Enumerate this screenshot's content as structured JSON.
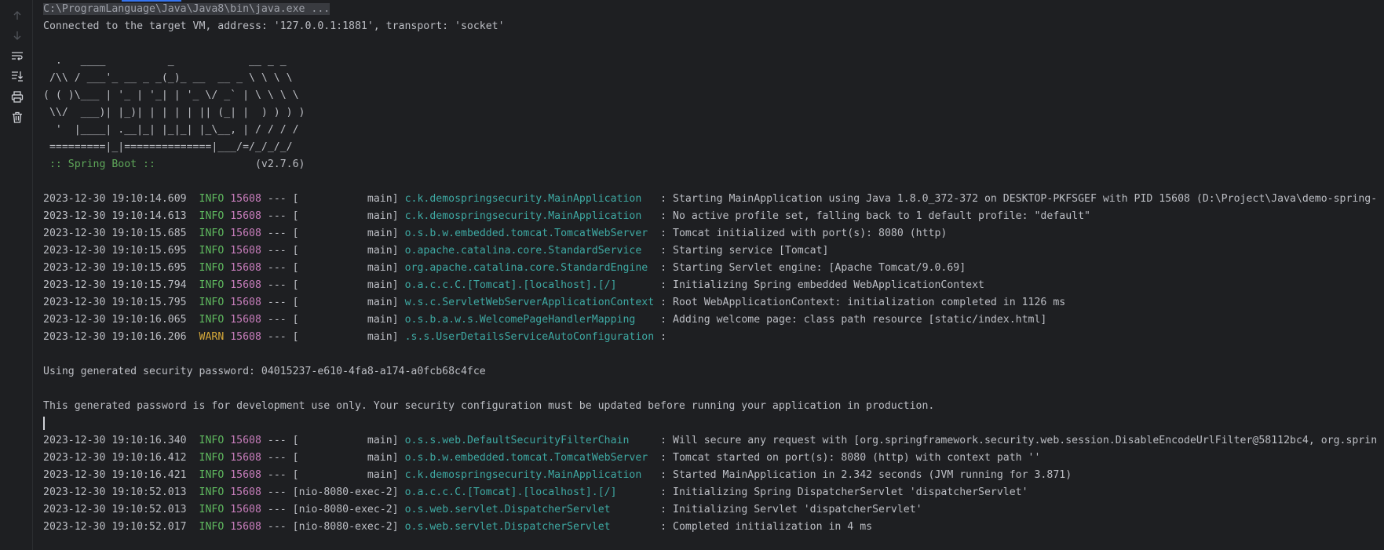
{
  "toolbar": {
    "icons": [
      "arrow-up-icon",
      "arrow-down-icon",
      "soft-wrap-icon",
      "scroll-to-end-icon",
      "print-icon",
      "trash-icon"
    ]
  },
  "console": {
    "command": "C:\\ProgramLanguage\\Java\\Java8\\bin\\java.exe ...",
    "connected": "Connected to the target VM, address: '127.0.0.1:1881', transport: 'socket'",
    "banner": [
      "",
      "  .   ____          _            __ _ _",
      " /\\\\ / ___'_ __ _ _(_)_ __  __ _ \\ \\ \\ \\",
      "( ( )\\___ | '_ | '_| | '_ \\/ _` | \\ \\ \\ \\",
      " \\\\/  ___)| |_)| | | | | || (_| |  ) ) ) )",
      "  '  |____| .__|_| |_|_| |_\\__, | / / / /",
      " =========|_|==============|___/=/_/_/_/"
    ],
    "boot_label": " :: Spring Boot :: ",
    "boot_version": "               (v2.7.6)",
    "logs1": [
      {
        "ts": "2023-12-30 19:10:14.609",
        "level": "INFO",
        "pid": "15608",
        "thread": "[           main]",
        "logger": "c.k.demospringsecurity.MainApplication  ",
        "msg": ": Starting MainApplication using Java 1.8.0_372-372 on DESKTOP-PKFSGEF with PID 15608 (D:\\Project\\Java\\demo-spring-"
      },
      {
        "ts": "2023-12-30 19:10:14.613",
        "level": "INFO",
        "pid": "15608",
        "thread": "[           main]",
        "logger": "c.k.demospringsecurity.MainApplication  ",
        "msg": ": No active profile set, falling back to 1 default profile: \"default\""
      },
      {
        "ts": "2023-12-30 19:10:15.685",
        "level": "INFO",
        "pid": "15608",
        "thread": "[           main]",
        "logger": "o.s.b.w.embedded.tomcat.TomcatWebServer ",
        "msg": ": Tomcat initialized with port(s): 8080 (http)"
      },
      {
        "ts": "2023-12-30 19:10:15.695",
        "level": "INFO",
        "pid": "15608",
        "thread": "[           main]",
        "logger": "o.apache.catalina.core.StandardService  ",
        "msg": ": Starting service [Tomcat]"
      },
      {
        "ts": "2023-12-30 19:10:15.695",
        "level": "INFO",
        "pid": "15608",
        "thread": "[           main]",
        "logger": "org.apache.catalina.core.StandardEngine ",
        "msg": ": Starting Servlet engine: [Apache Tomcat/9.0.69]"
      },
      {
        "ts": "2023-12-30 19:10:15.794",
        "level": "INFO",
        "pid": "15608",
        "thread": "[           main]",
        "logger": "o.a.c.c.C.[Tomcat].[localhost].[/]      ",
        "msg": ": Initializing Spring embedded WebApplicationContext"
      },
      {
        "ts": "2023-12-30 19:10:15.795",
        "level": "INFO",
        "pid": "15608",
        "thread": "[           main]",
        "logger": "w.s.c.ServletWebServerApplicationContext",
        "msg": ": Root WebApplicationContext: initialization completed in 1126 ms"
      },
      {
        "ts": "2023-12-30 19:10:16.065",
        "level": "INFO",
        "pid": "15608",
        "thread": "[           main]",
        "logger": "o.s.b.a.w.s.WelcomePageHandlerMapping   ",
        "msg": ": Adding welcome page: class path resource [static/index.html]"
      },
      {
        "ts": "2023-12-30 19:10:16.206",
        "level": "WARN",
        "pid": "15608",
        "thread": "[           main]",
        "logger": ".s.s.UserDetailsServiceAutoConfiguration",
        "msg": ":"
      }
    ],
    "password_line": "Using generated security password: 04015237-e610-4fa8-a174-a0fcb68c4fce",
    "dev_note": "This generated password is for development use only. Your security configuration must be updated before running your application in production.",
    "logs2": [
      {
        "ts": "2023-12-30 19:10:16.340",
        "level": "INFO",
        "pid": "15608",
        "thread": "[           main]",
        "logger": "o.s.s.web.DefaultSecurityFilterChain    ",
        "msg": ": Will secure any request with [org.springframework.security.web.session.DisableEncodeUrlFilter@58112bc4, org.sprin"
      },
      {
        "ts": "2023-12-30 19:10:16.412",
        "level": "INFO",
        "pid": "15608",
        "thread": "[           main]",
        "logger": "o.s.b.w.embedded.tomcat.TomcatWebServer ",
        "msg": ": Tomcat started on port(s): 8080 (http) with context path ''"
      },
      {
        "ts": "2023-12-30 19:10:16.421",
        "level": "INFO",
        "pid": "15608",
        "thread": "[           main]",
        "logger": "c.k.demospringsecurity.MainApplication  ",
        "msg": ": Started MainApplication in 2.342 seconds (JVM running for 3.871)"
      },
      {
        "ts": "2023-12-30 19:10:52.013",
        "level": "INFO",
        "pid": "15608",
        "thread": "[nio-8080-exec-2]",
        "logger": "o.a.c.c.C.[Tomcat].[localhost].[/]      ",
        "msg": ": Initializing Spring DispatcherServlet 'dispatcherServlet'"
      },
      {
        "ts": "2023-12-30 19:10:52.013",
        "level": "INFO",
        "pid": "15608",
        "thread": "[nio-8080-exec-2]",
        "logger": "o.s.web.servlet.DispatcherServlet       ",
        "msg": ": Initializing Servlet 'dispatcherServlet'"
      },
      {
        "ts": "2023-12-30 19:10:52.017",
        "level": "INFO",
        "pid": "15608",
        "thread": "[nio-8080-exec-2]",
        "logger": "o.s.web.servlet.DispatcherServlet       ",
        "msg": ": Completed initialization in 4 ms"
      }
    ]
  }
}
